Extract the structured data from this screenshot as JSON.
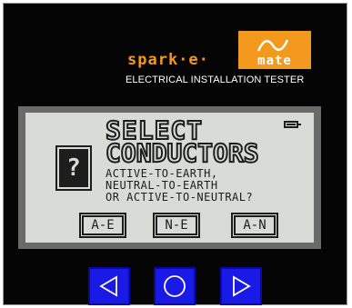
{
  "brand": {
    "wordmark": "spark·e·",
    "logo_word": "mate",
    "tagline": "ELECTRICAL INSTALLATION TESTER",
    "accent_color": "#f39a1e"
  },
  "screen": {
    "title_line_1": "SELECT",
    "title_line_2": "CONDUCTORS",
    "question_mark": "?",
    "prompt_lines": [
      "ACTIVE-TO-EARTH,",
      "NEUTRAL-TO-EARTH",
      "OR ACTIVE-TO-NEUTRAL?"
    ],
    "battery_icon": "battery-icon",
    "soft_keys": [
      {
        "label": "A-E"
      },
      {
        "label": "N-E"
      },
      {
        "label": "A-N"
      }
    ]
  },
  "buttons": {
    "color": "#1a1ae6",
    "items": [
      {
        "icon": "left-triangle-icon"
      },
      {
        "icon": "circle-icon"
      },
      {
        "icon": "right-triangle-icon"
      }
    ]
  }
}
